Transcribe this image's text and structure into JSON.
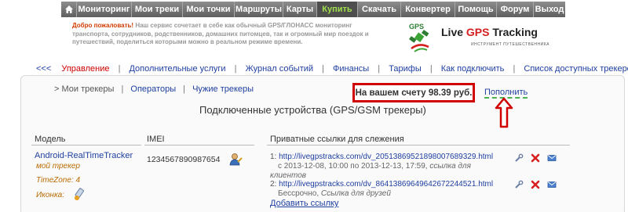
{
  "topnav": {
    "items": [
      {
        "label": "Мониторинг"
      },
      {
        "label": "Мои треки"
      },
      {
        "label": "Мои точки"
      },
      {
        "label": "Маршруты"
      },
      {
        "label": "Карты"
      },
      {
        "label": "Купить",
        "active": true
      },
      {
        "label": "Скачать"
      },
      {
        "label": "Конвертер"
      },
      {
        "label": "Помощь"
      },
      {
        "label": "Форум"
      },
      {
        "label": "Выход"
      }
    ]
  },
  "banner": {
    "welcome_title": "Добро пожаловать!",
    "welcome_text": "Наш сервис сочетает в себе как обычный GPS/ГЛОНАСС мониторинг транспорта, сотрудников, родственников, домашних питомцев, так и огромный мир поездок и путешествий, поделиться которыми можно в реальном режиме времени.",
    "logo_prefix": "Live ",
    "logo_gps": "GPS",
    "logo_suffix": " Tracking",
    "logo_subtitle": "ИНСТРУМЕНТ ПУТЕШЕСТВЕННИКА"
  },
  "submenu": {
    "back": "<<<",
    "items": [
      "Управление",
      "Дополнительные услуги",
      "Журнал событий",
      "Финансы",
      "Тарифы",
      "Как подключить",
      "Список доступных трекеров"
    ]
  },
  "tabs": {
    "current": "> Мои трекеры",
    "others": [
      "Операторы",
      "Чужие трекеры"
    ]
  },
  "balance": {
    "text": "На вашем счету 98.39 руб.",
    "topup": "Пополнить"
  },
  "heading": "Подключенные устройства (GPS/GSM трекеры)",
  "table": {
    "headers": {
      "model": "Модель",
      "imei": "IMEI",
      "links": "Приватные ссылки для слежения"
    },
    "device": {
      "name": "Android-RealTimeTracker",
      "note": "мой трекер",
      "timezone": "TimeZone: 4",
      "icon_label": "Иконка:",
      "imei": "1234567890987654"
    },
    "links": [
      {
        "num": "1:",
        "url": "http://livegpstracks.com/dv_2051386952189800768932​9.html",
        "dates": "с 2013-12-08, 10:00 по 2013-12-13, 17:59,",
        "name": "ссылка для клиентов"
      },
      {
        "num": "2:",
        "url": "http://livegpstracks.com/dv_8641386964964267224452​1.html",
        "dates": "Бессрочно,",
        "name": "Ссылка для друзей"
      }
    ],
    "add_link": "Добавить ссылку"
  },
  "colors": {
    "nav_bg": "#6f6f6f",
    "nav_active": "#9fe04a",
    "link": "#1e3fa0",
    "accent_red": "#d00000",
    "note_orange": "#b86b00"
  }
}
